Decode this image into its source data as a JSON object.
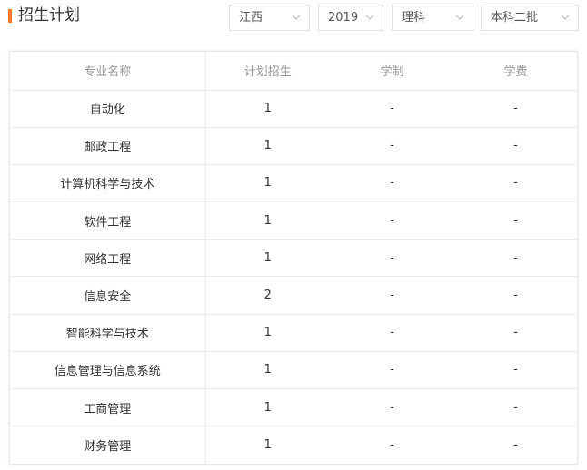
{
  "header": {
    "title": "招生计划",
    "filters": {
      "province": "江西",
      "year": "2019",
      "subject": "理科",
      "batch": "本科二批"
    }
  },
  "table": {
    "columns": [
      "专业名称",
      "计划招生",
      "学制",
      "学费"
    ],
    "rows": [
      [
        "自动化",
        "1",
        "-",
        "-"
      ],
      [
        "邮政工程",
        "1",
        "-",
        "-"
      ],
      [
        "计算机科学与技术",
        "1",
        "-",
        "-"
      ],
      [
        "软件工程",
        "1",
        "-",
        "-"
      ],
      [
        "网络工程",
        "1",
        "-",
        "-"
      ],
      [
        "信息安全",
        "2",
        "-",
        "-"
      ],
      [
        "智能科学与技术",
        "1",
        "-",
        "-"
      ],
      [
        "信息管理与信息系统",
        "1",
        "-",
        "-"
      ],
      [
        "工商管理",
        "1",
        "-",
        "-"
      ],
      [
        "财务管理",
        "1",
        "-",
        "-"
      ]
    ]
  },
  "colors": {
    "accent": "#f5792a",
    "header_text": "#999999",
    "border": "#ececec"
  },
  "icons": {
    "dropdown": "chevron-down-icon"
  }
}
